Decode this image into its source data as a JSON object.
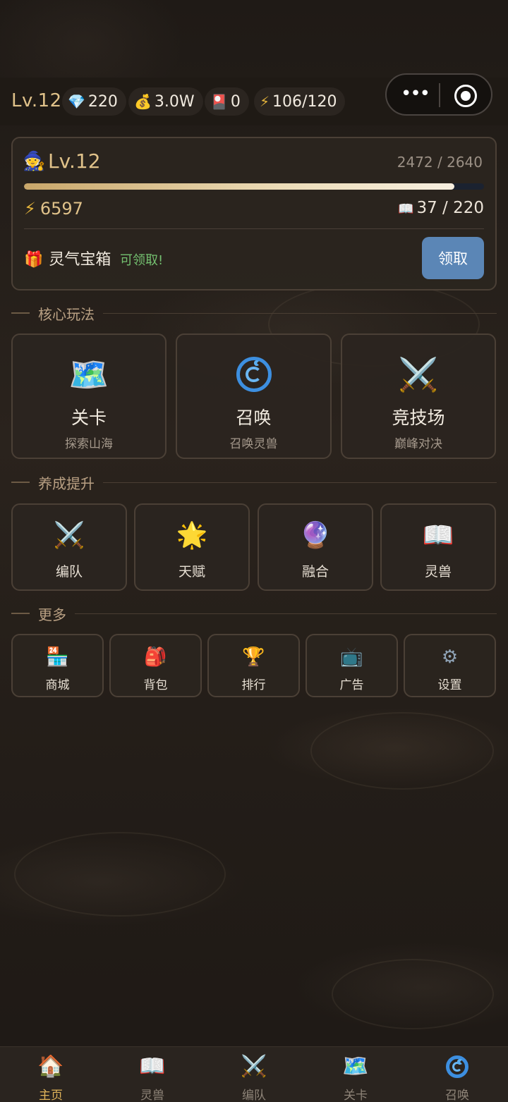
{
  "topbar": {
    "level": "Lv.12",
    "diamonds": {
      "icon": "diamond-icon",
      "value": "220"
    },
    "gold": {
      "icon": "money-bag-icon",
      "value": "3.0W"
    },
    "tickets": {
      "icon": "ticket-icon",
      "value": "0"
    },
    "stamina": {
      "icon": "lightning-icon",
      "value": "106/120"
    }
  },
  "profile": {
    "avatar_icon": "mage-icon",
    "level": "Lv.12",
    "exp_text": "2472 / 2640",
    "exp_fraction": 0.936,
    "power": "6597",
    "collection": "37 / 220",
    "chest_label": "灵气宝箱",
    "chest_status": "可领取!",
    "claim_label": "领取"
  },
  "sections": {
    "core": "核心玩法",
    "growth": "养成提升",
    "more": "更多"
  },
  "core_tiles": [
    {
      "icon": "world-map-icon",
      "label": "关卡",
      "sub": "探索山海"
    },
    {
      "icon": "cyclone-icon",
      "label": "召唤",
      "sub": "召唤灵兽"
    },
    {
      "icon": "crossed-swords-icon",
      "label": "竞技场",
      "sub": "巅峰对决"
    }
  ],
  "growth_tiles": [
    {
      "icon": "crossed-swords-icon",
      "label": "编队"
    },
    {
      "icon": "sparkle-star-icon",
      "label": "天赋"
    },
    {
      "icon": "crystal-ball-icon",
      "label": "融合"
    },
    {
      "icon": "open-book-icon",
      "label": "灵兽"
    }
  ],
  "more_tiles": [
    {
      "icon": "store-icon",
      "label": "商城"
    },
    {
      "icon": "backpack-icon",
      "label": "背包"
    },
    {
      "icon": "trophy-icon",
      "label": "排行"
    },
    {
      "icon": "tv-icon",
      "label": "广告"
    },
    {
      "icon": "gear-icon",
      "label": "设置"
    }
  ],
  "bottom_nav": [
    {
      "icon": "house-icon",
      "label": "主页",
      "active": true
    },
    {
      "icon": "open-book-icon",
      "label": "灵兽"
    },
    {
      "icon": "crossed-swords-icon",
      "label": "编队"
    },
    {
      "icon": "world-map-icon",
      "label": "关卡"
    },
    {
      "icon": "cyclone-icon",
      "label": "召唤"
    }
  ],
  "colors": {
    "accent_gold": "#e0c28a",
    "claim_button": "#5b86b6",
    "claimable_green": "#74c070",
    "nav_active": "#e0b45a"
  }
}
